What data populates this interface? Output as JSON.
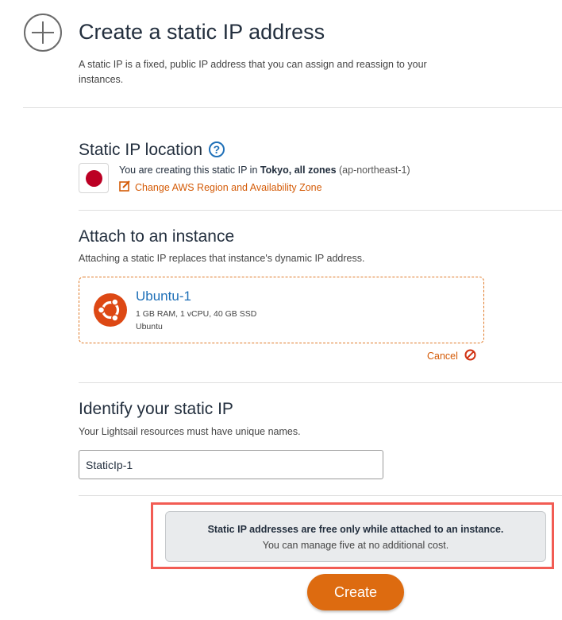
{
  "header": {
    "title": "Create a static IP address",
    "description": "A static IP is a fixed, public IP address that you can assign and reassign to your instances."
  },
  "location": {
    "title": "Static IP location",
    "help_icon": "question-mark-icon",
    "text_prefix": "You are creating this static IP in ",
    "region_name": "Tokyo, all zones",
    "region_code": "(ap-northeast-1)",
    "flag": "japan-flag",
    "change_link": "Change AWS Region and Availability Zone"
  },
  "attach": {
    "title": "Attach to an instance",
    "description": "Attaching a static IP replaces that instance's dynamic IP address.",
    "instance": {
      "name": "Ubuntu-1",
      "specs": "1 GB RAM, 1 vCPU, 40 GB SSD",
      "os": "Ubuntu",
      "icon": "ubuntu-icon"
    },
    "cancel_label": "Cancel"
  },
  "identify": {
    "title": "Identify your static IP",
    "description": "Your Lightsail resources must have unique names.",
    "input_value": "StaticIp-1"
  },
  "notice": {
    "title": "Static IP addresses are free only while attached to an instance.",
    "subtitle": "You can manage five at no additional cost."
  },
  "actions": {
    "create_label": "Create"
  },
  "colors": {
    "accent": "#d45b07",
    "link_blue": "#1f70b8",
    "button": "#dd6b10",
    "highlight": "#f25c54"
  }
}
